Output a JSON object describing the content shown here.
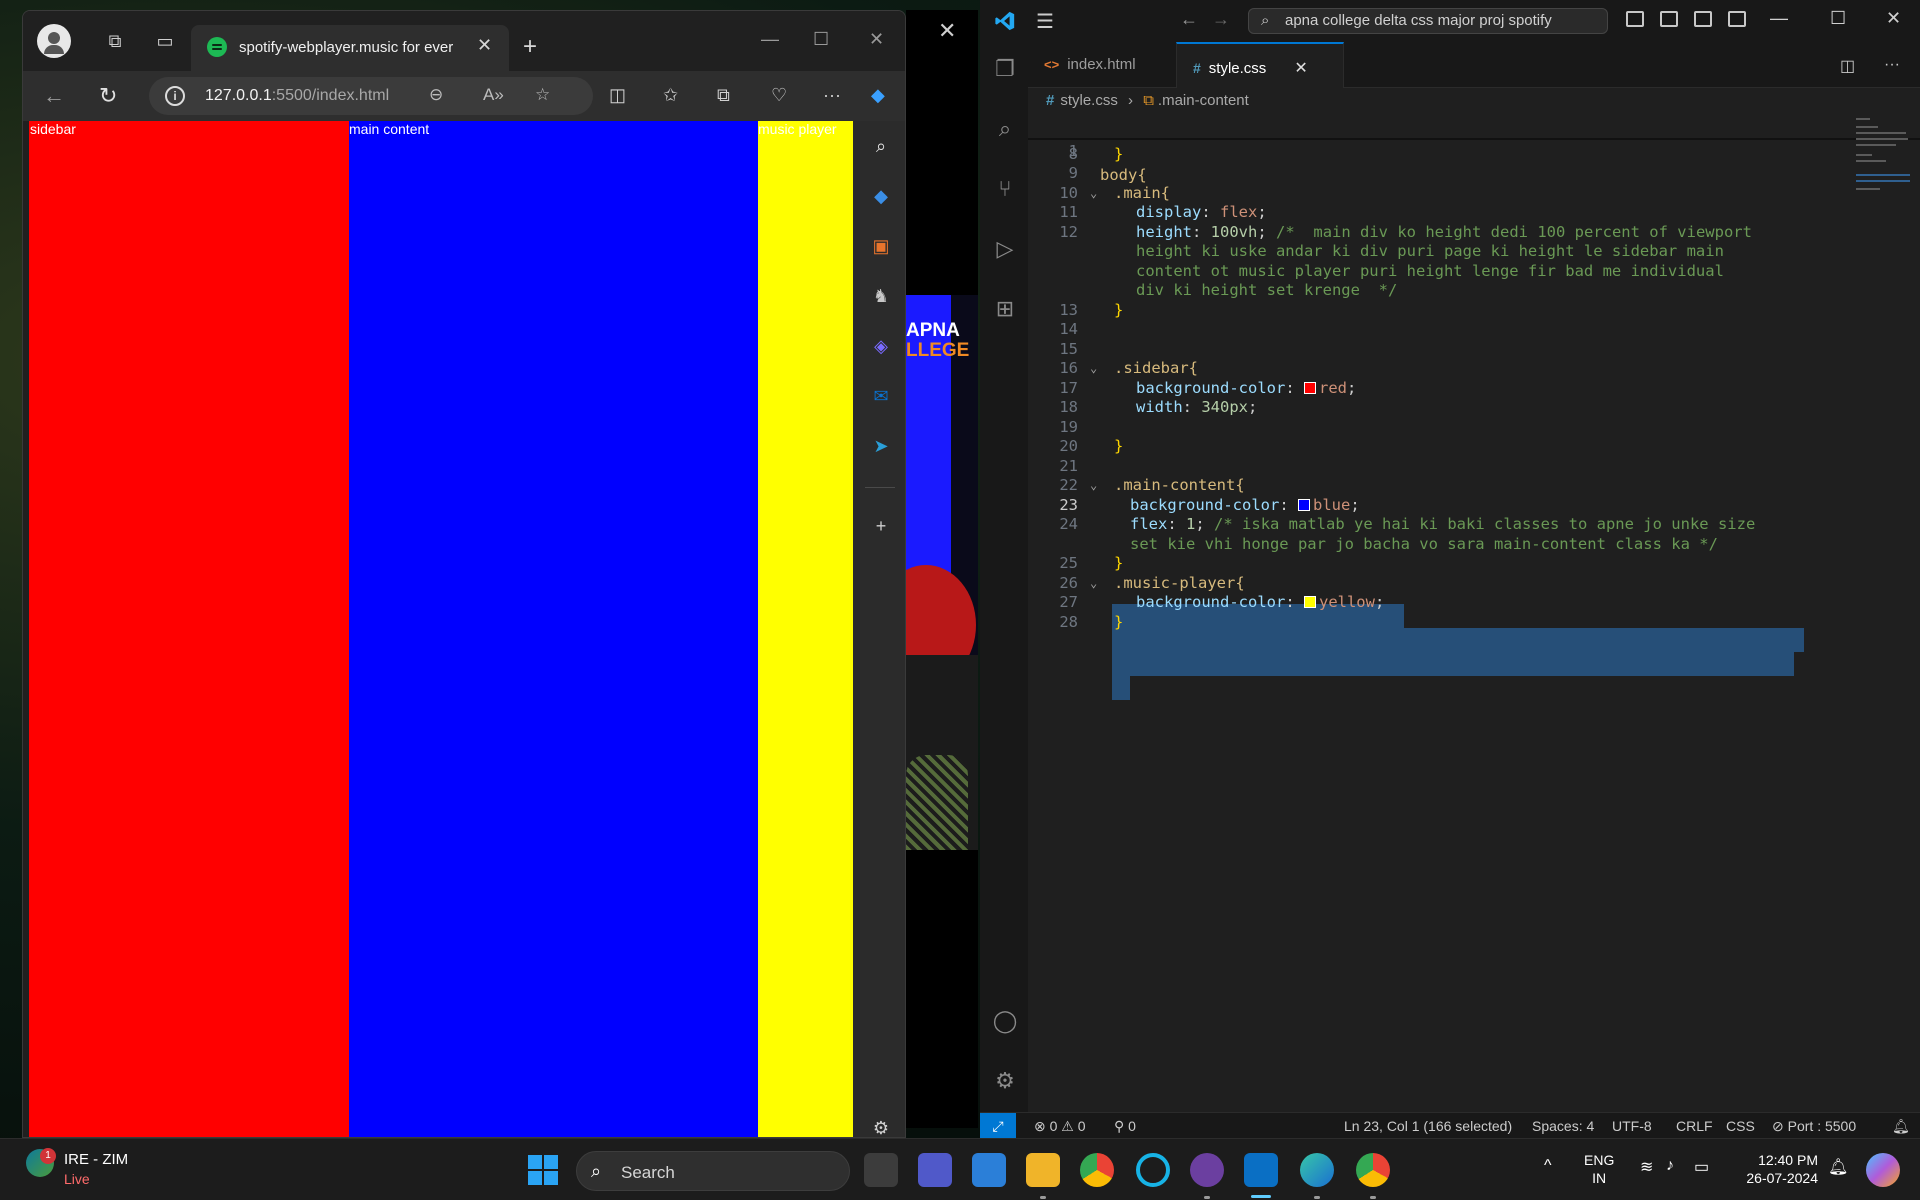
{
  "browser": {
    "tab_title": "spotify-webplayer.music for ever",
    "url_host": "127.0.0.1",
    "url_rest": ":5500/index.html",
    "page": {
      "sidebar_text": "sidebar",
      "main_text": "main content",
      "player_text": "music player",
      "colors": {
        "sidebar": "#ff0000",
        "main": "#0000ff",
        "player": "#ffff00"
      }
    }
  },
  "video": {
    "logo_line1": "APNA",
    "logo_line2": "LLEGE"
  },
  "vscode": {
    "search": "apna college delta css major proj spotify",
    "tabs": [
      {
        "label": "index.html",
        "icon": "html-icon",
        "active": false
      },
      {
        "label": "style.css",
        "icon": "css-icon",
        "active": true
      }
    ],
    "breadcrumb": {
      "file": "style.css",
      "symbol": ".main-content"
    },
    "sticky": {
      "line": "1",
      "text": "body{"
    },
    "lines": [
      {
        "n": "7",
        "text": ""
      },
      {
        "n": "8",
        "text": "}"
      },
      {
        "n": "9",
        "text": ""
      },
      {
        "n": "10",
        "text": ".main{"
      },
      {
        "n": "11",
        "prop": "display",
        "val": "flex"
      },
      {
        "n": "12",
        "prop": "height",
        "val": "100vh",
        "comment1": "/*  main div ko height dedi 100 percent of viewport",
        "comment2": "height ki uske andar ki div puri page ki height le sidebar main",
        "comment3": "content ot music player puri height lenge fir bad me individual",
        "comment4": "div ki height set krenge  */"
      },
      {
        "n": "13",
        "text": "}"
      },
      {
        "n": "14",
        "text": ""
      },
      {
        "n": "15",
        "text": ""
      },
      {
        "n": "16",
        "text": ".sidebar{"
      },
      {
        "n": "17",
        "prop": "background-color",
        "val": "red",
        "swatch": "#ff0000"
      },
      {
        "n": "18",
        "prop": "width",
        "val": "340px"
      },
      {
        "n": "19",
        "text": ""
      },
      {
        "n": "20",
        "text": "}"
      },
      {
        "n": "21",
        "text": ""
      },
      {
        "n": "22",
        "text": ".main-content{"
      },
      {
        "n": "23",
        "prop": "background-color",
        "val": "blue",
        "swatch": "#0000ff"
      },
      {
        "n": "24",
        "prop": "flex",
        "val": "1",
        "comment1": "/* iska matlab ye hai ki baki classes to apne jo unke size",
        "comment2": "set kie vhi honge par jo bacha vo sara main-content class ka */"
      },
      {
        "n": "25",
        "text": "}"
      },
      {
        "n": "26",
        "text": ".music-player{"
      },
      {
        "n": "27",
        "prop": "background-color",
        "val": "yellow",
        "swatch": "#ffff00"
      },
      {
        "n": "28",
        "text": "}"
      }
    ],
    "status": {
      "errors": "0",
      "warnings": "0",
      "ports": "0",
      "position": "Ln 23, Col 1 (166 selected)",
      "spaces": "Spaces: 4",
      "encoding": "UTF-8",
      "eol": "CRLF",
      "language": "CSS",
      "port": "Port : 5500"
    }
  },
  "taskbar": {
    "weather_title": "IRE - ZIM",
    "weather_sub": "Live",
    "weather_badge": "1",
    "search_label": "Search",
    "lang1": "ENG",
    "lang2": "IN",
    "time": "12:40 PM",
    "date": "26-07-2024",
    "accent": "#60cdff"
  }
}
